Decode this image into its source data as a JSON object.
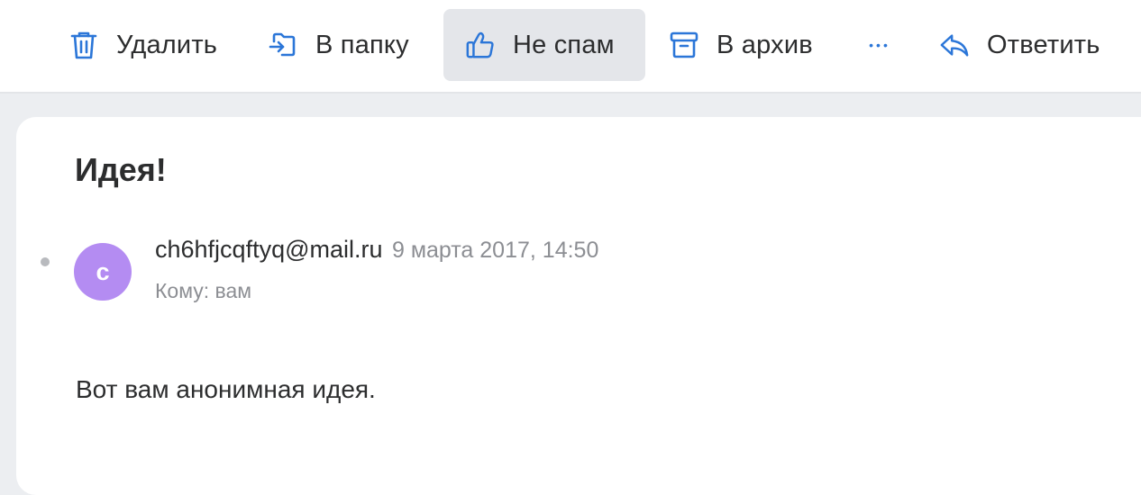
{
  "toolbar": {
    "delete_label": "Удалить",
    "move_label": "В папку",
    "notspam_label": "Не спам",
    "archive_label": "В архив",
    "more_label": "•••",
    "reply_label": "Ответить"
  },
  "colors": {
    "accent": "#2b76d8",
    "avatar": "#b48cf2",
    "active_button_bg": "#e4e6ea"
  },
  "icons": {
    "delete": "trash-icon",
    "move": "folder-move-icon",
    "notspam": "thumbs-up-icon",
    "archive": "archive-box-icon",
    "more": "more-dots-icon",
    "reply": "reply-arrow-icon"
  },
  "message": {
    "subject": "Идея!",
    "avatar_letter": "c",
    "sender": "ch6hfjcqftyq@mail.ru",
    "date": "9 марта 2017, 14:50",
    "recipient": "Кому: вам",
    "body_line1": "Вот вам анонимная идея."
  }
}
